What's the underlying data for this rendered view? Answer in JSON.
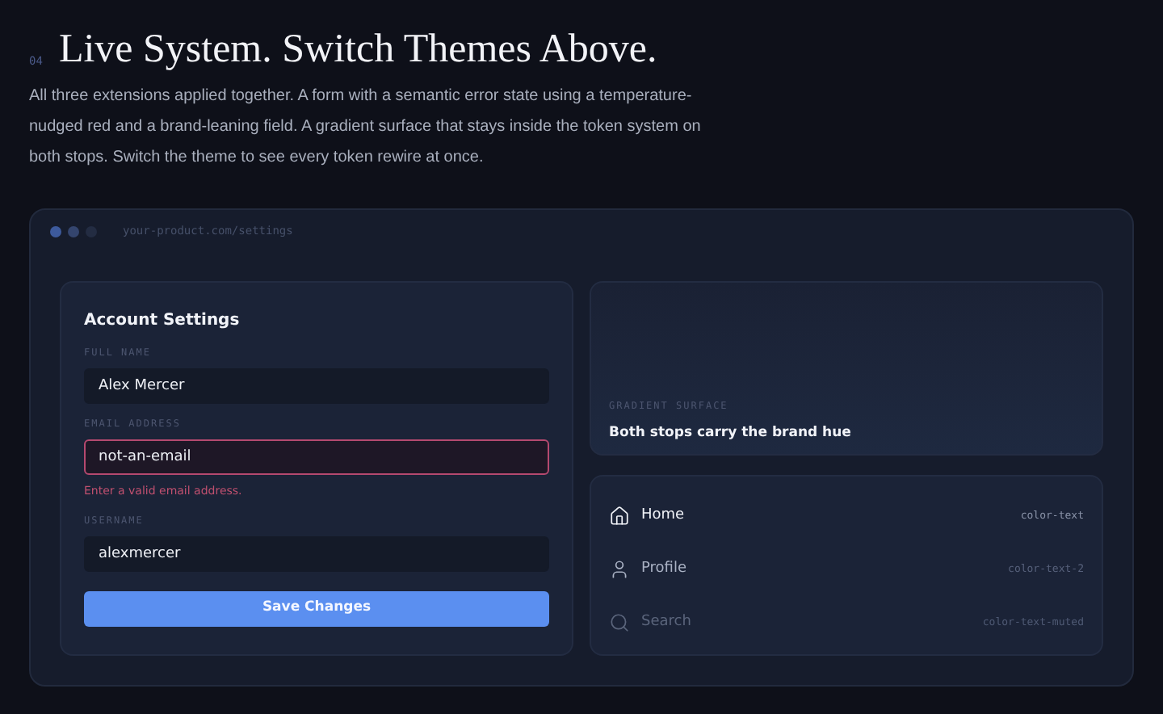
{
  "section": {
    "number": "04",
    "title": "Live System. Switch Themes Above.",
    "description": "All three extensions applied together. A form with a semantic error state using a temperature-nudged red and a brand-leaning field. A gradient surface that stays inside the token system on both stops. Switch the theme to see every token rewire at once."
  },
  "browser": {
    "url": "your-product.com/settings"
  },
  "form": {
    "title": "Account Settings",
    "fields": [
      {
        "label": "FULL NAME",
        "value": "Alex Mercer",
        "error": false
      },
      {
        "label": "EMAIL ADDRESS",
        "value": "not-an-email",
        "error": true,
        "message": "Enter a valid email address."
      },
      {
        "label": "USERNAME",
        "value": "alexmercer",
        "error": false
      }
    ],
    "button": "Save Changes"
  },
  "gradient_card": {
    "label": "GRADIENT SURFACE",
    "caption": "Both stops carry the brand hue"
  },
  "nav": [
    {
      "label": "Home",
      "token": "color-text",
      "kind": "primary"
    },
    {
      "label": "Profile",
      "token": "color-text-2",
      "kind": "secondary"
    },
    {
      "label": "Search",
      "token": "color-text-muted",
      "kind": "muted"
    }
  ]
}
